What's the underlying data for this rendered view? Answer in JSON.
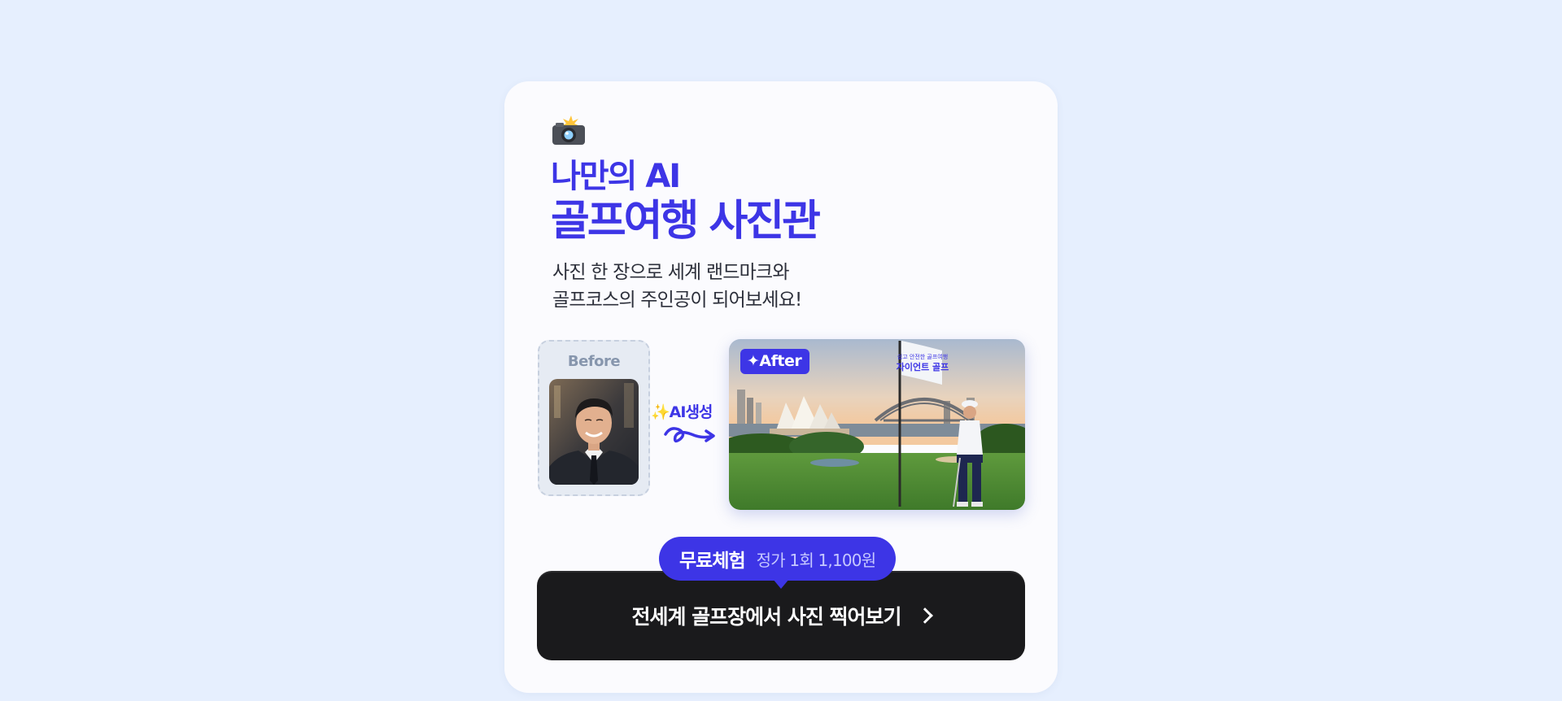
{
  "header": {
    "camera_icon": "camera-with-flash-icon",
    "title_line1": "나만의 AI",
    "title_line2": "골프여행 사진관",
    "subtitle_line1": "사진 한 장으로 세계 랜드마크와",
    "subtitle_line2": "골프코스의 주인공이 되어보세요!"
  },
  "comparison": {
    "before_label": "Before",
    "ai_label": "AI생성",
    "ai_icon": "sparkles-icon",
    "after_label": "After",
    "flag_line1": "쉽고 안전한 골프여행",
    "flag_line2": "자이언트 골프"
  },
  "cta": {
    "free_label": "무료체험",
    "price_label": "정가 1회 1,100원",
    "button_label": "전세계 골프장에서 사진 찍어보기",
    "button_icon": "chevron-right-icon"
  },
  "colors": {
    "page_background": "#e6effe",
    "card_background": "#fbfbfe",
    "accent": "#3d35e6",
    "button_background": "#1a1a1c"
  }
}
